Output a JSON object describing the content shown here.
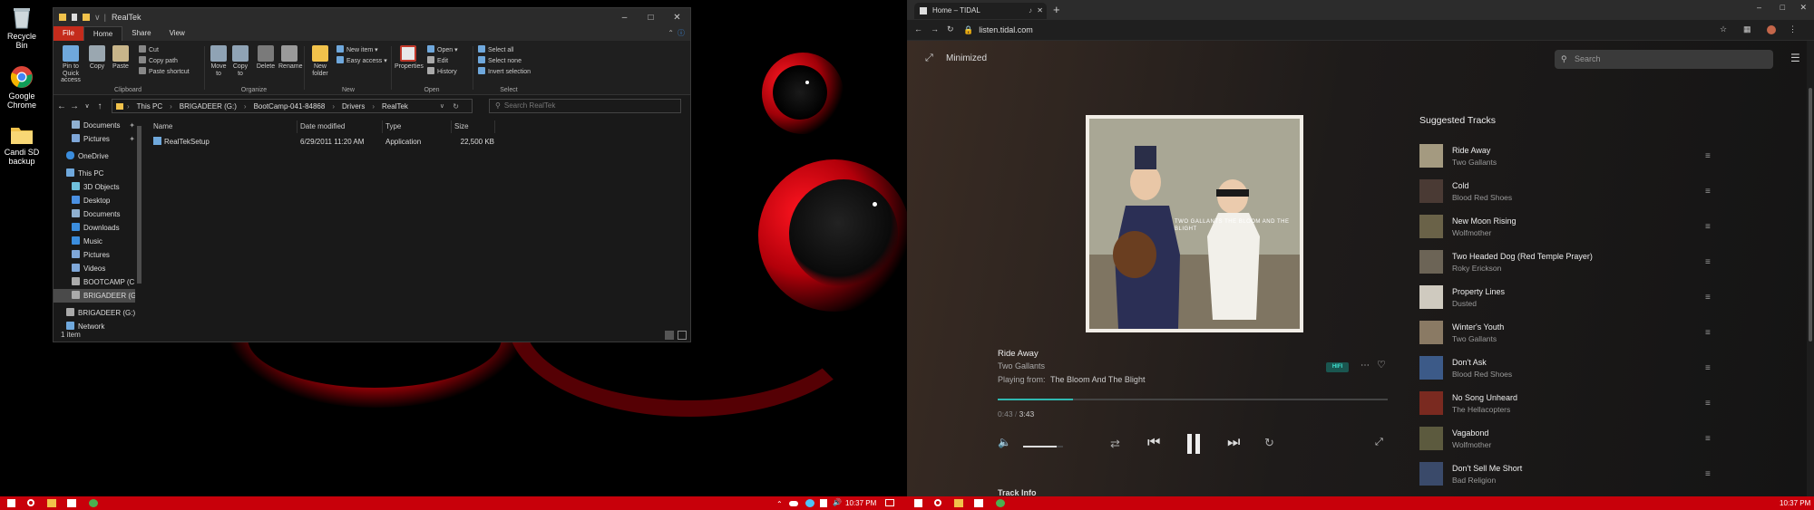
{
  "desktop": {
    "icons": [
      {
        "label": "Recycle Bin",
        "icon": "recycle-bin-icon"
      },
      {
        "label": "Google Chrome",
        "icon": "chrome-icon"
      },
      {
        "label": "Candi SD backup",
        "icon": "folder-icon"
      }
    ]
  },
  "explorer": {
    "title": "RealTek",
    "qat_chevron": "∨",
    "tabs": [
      "File",
      "Home",
      "Share",
      "View"
    ],
    "ribbon": {
      "clipboard": {
        "group": "Clipboard",
        "pin": "Pin to Quick access",
        "copy": "Copy",
        "paste": "Paste",
        "cut": "Cut",
        "copy_path": "Copy path",
        "paste_shortcut": "Paste shortcut"
      },
      "organize": {
        "group": "Organize",
        "move_to": "Move to",
        "copy_to": "Copy to",
        "delete": "Delete",
        "rename": "Rename"
      },
      "new": {
        "group": "New",
        "new_folder": "New folder",
        "new_item": "New item",
        "easy_access": "Easy access"
      },
      "open": {
        "group": "Open",
        "properties": "Properties",
        "open": "Open",
        "edit": "Edit",
        "history": "History"
      },
      "select": {
        "group": "Select",
        "select_all": "Select all",
        "select_none": "Select none",
        "invert": "Invert selection"
      }
    },
    "address": {
      "path": [
        "This PC",
        "BRIGADEER (G:)",
        "BootCamp-041-84868",
        "Drivers",
        "RealTek"
      ],
      "search_placeholder": "Search RealTek"
    },
    "nav": [
      {
        "label": "Documents",
        "icon": "documents-icon",
        "pinned": true
      },
      {
        "label": "Pictures",
        "icon": "pictures-icon",
        "pinned": true
      },
      {
        "label": "OneDrive",
        "icon": "onedrive-icon"
      },
      {
        "label": "This PC",
        "icon": "pc-icon"
      },
      {
        "label": "3D Objects",
        "icon": "3d-objects-icon"
      },
      {
        "label": "Desktop",
        "icon": "desktop-icon"
      },
      {
        "label": "Documents",
        "icon": "documents-icon"
      },
      {
        "label": "Downloads",
        "icon": "downloads-icon"
      },
      {
        "label": "Music",
        "icon": "music-icon"
      },
      {
        "label": "Pictures",
        "icon": "pictures-icon"
      },
      {
        "label": "Videos",
        "icon": "videos-icon"
      },
      {
        "label": "BOOTCAMP (C:)",
        "icon": "drive-icon"
      },
      {
        "label": "BRIGADEER (G:)",
        "icon": "drive-icon",
        "selected": true
      },
      {
        "label": "BRIGADEER (G:)",
        "icon": "drive-icon"
      },
      {
        "label": "Network",
        "icon": "network-icon"
      }
    ],
    "columns": [
      "Name",
      "Date modified",
      "Type",
      "Size"
    ],
    "files": [
      {
        "name": "RealTekSetup",
        "date": "6/29/2011 11:20 AM",
        "type": "Application",
        "size": "22,500 KB"
      }
    ],
    "status": "1 item"
  },
  "taskbar_left": {
    "time": "10:37 PM"
  },
  "taskbar_right": {
    "time": "10:37 PM"
  },
  "browser": {
    "tab_title": "Home – TIDAL",
    "url": "listen.tidal.com"
  },
  "tidal": {
    "minimized_label": "Minimized",
    "search_placeholder": "Search",
    "cover_text": "TWO GALLANTS THE BLOOM AND THE BLIGHT",
    "now_playing": {
      "title": "Ride Away",
      "artist": "Two Gallants",
      "playing_from_label": "Playing from:",
      "playing_from": "The Bloom And The Blight",
      "quality": "HIFI",
      "elapsed": "0:43",
      "divider": "/",
      "duration": "3:43",
      "progress_fraction": 0.193,
      "volume_fraction": 0.85
    },
    "bottom_label": "Track Info",
    "suggested_title": "Suggested Tracks",
    "suggested": [
      {
        "title": "Ride Away",
        "artist": "Two Gallants",
        "color": "#a49a80"
      },
      {
        "title": "Cold",
        "artist": "Blood Red Shoes",
        "color": "#4a3a34"
      },
      {
        "title": "New Moon Rising",
        "artist": "Wolfmother",
        "color": "#6a6248"
      },
      {
        "title": "Two Headed Dog (Red Temple Prayer)",
        "artist": "Roky Erickson",
        "color": "#6c6456"
      },
      {
        "title": "Property Lines",
        "artist": "Dusted",
        "color": "#cfcabf"
      },
      {
        "title": "Winter's Youth",
        "artist": "Two Gallants",
        "color": "#8a7a64"
      },
      {
        "title": "Don't Ask",
        "artist": "Blood Red Shoes",
        "color": "#3c5a88"
      },
      {
        "title": "No Song Unheard",
        "artist": "The Hellacopters",
        "color": "#7a2a20"
      },
      {
        "title": "Vagabond",
        "artist": "Wolfmother",
        "color": "#5c5a3e"
      },
      {
        "title": "Don't Sell Me Short",
        "artist": "Bad Religion",
        "color": "#3a4a6a"
      }
    ]
  },
  "colors": {
    "accent_red": "#c8000a",
    "tidal_accent": "#30b8b0"
  }
}
